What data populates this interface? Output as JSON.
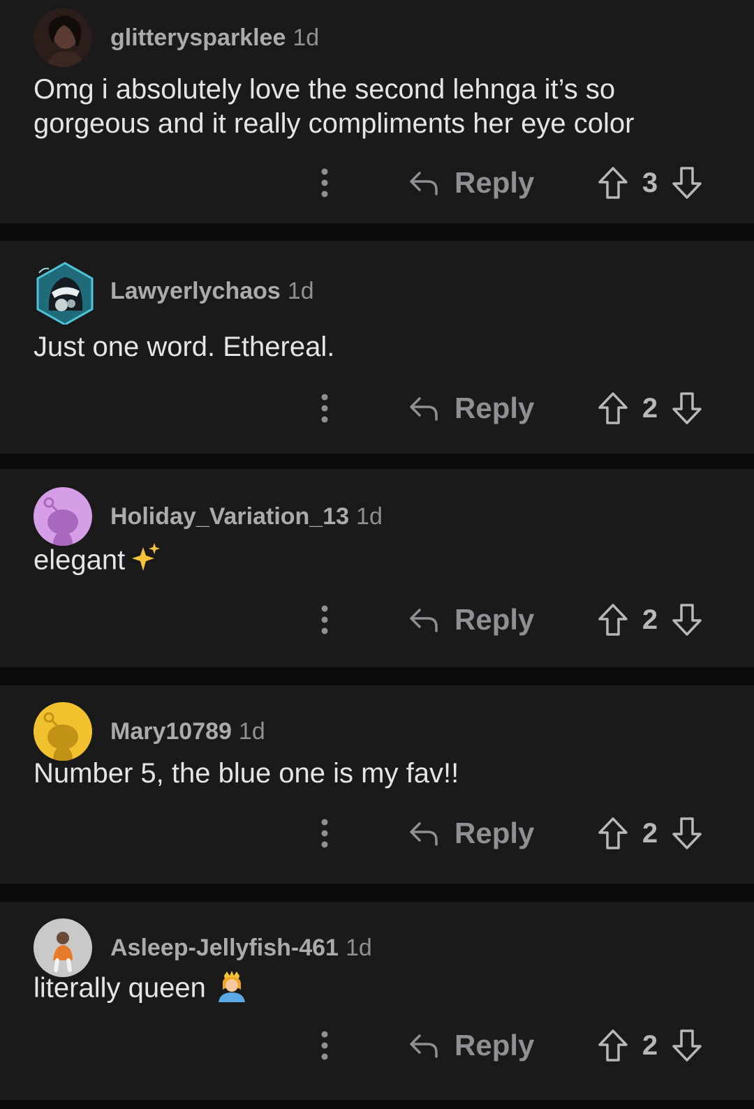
{
  "reply_label": "Reply",
  "comments": [
    {
      "username": "glitterysparklee",
      "age": "1d",
      "text": "Omg i absolutely love the second lehnga it’s so gorgeous and it really compliments her eye color",
      "score": "3",
      "avatar": "photo-avatar-icon"
    },
    {
      "username": "Lawyerlychaos",
      "age": "1d",
      "text": "Just one word. Ethereal.",
      "score": "2",
      "avatar": "hooded-gasmask-avatar-icon"
    },
    {
      "username": "Holiday_Variation_13",
      "age": "1d",
      "text": "elegant",
      "emoji": "sparkles-icon",
      "score": "2",
      "avatar": "snoo-avatar-icon",
      "avatar_color": "#d69ee6"
    },
    {
      "username": "Mary10789",
      "age": "1d",
      "text": "Number 5, the blue one is my fav!!",
      "score": "2",
      "avatar": "snoo-avatar-icon",
      "avatar_color": "#f2c12e"
    },
    {
      "username": "Asleep-Jellyfish-461",
      "age": "1d",
      "text": "literally queen",
      "emoji": "princess-icon",
      "score": "2",
      "avatar": "character-avatar-icon"
    }
  ],
  "colors": {
    "background": "#0b0b0c",
    "card": "#1a1a1b",
    "text": "#e3e5e7",
    "muted": "#8e9093"
  }
}
